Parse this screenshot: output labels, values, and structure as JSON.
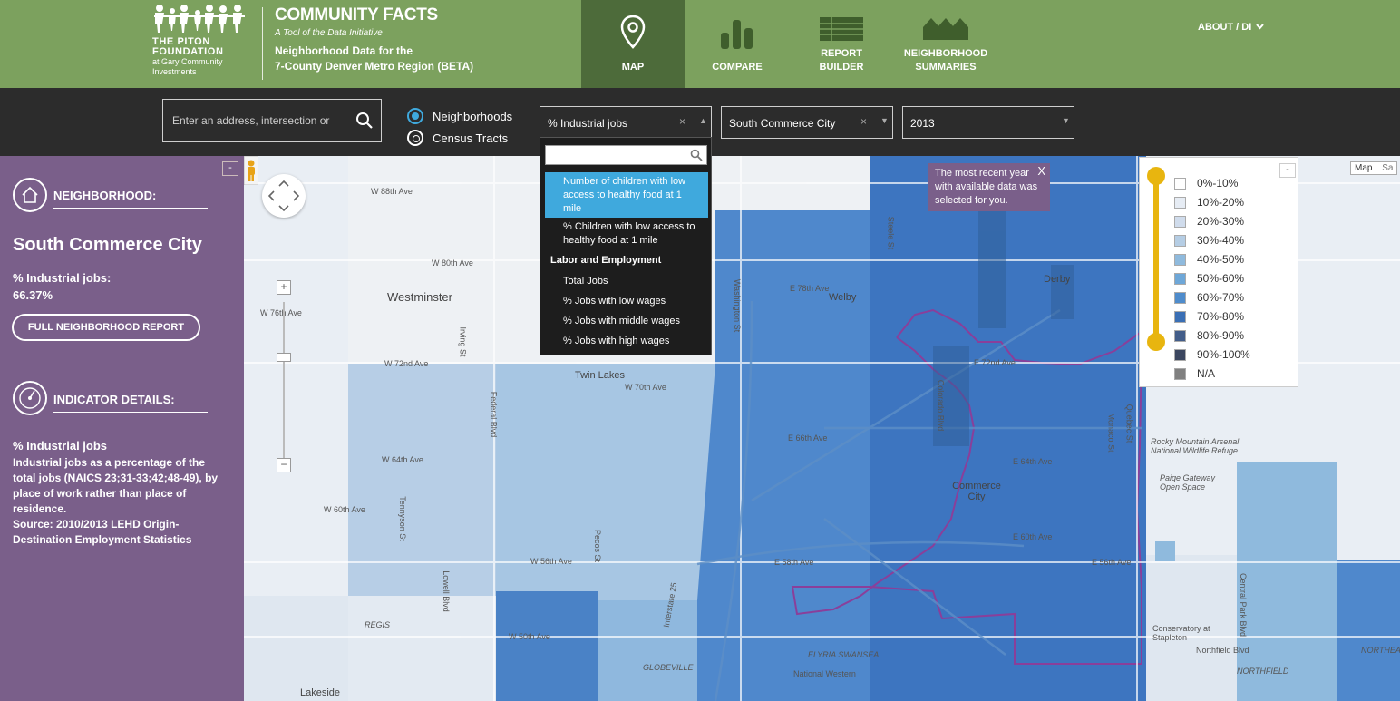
{
  "header": {
    "logo_name_line1": "THE PITON",
    "logo_name_line2": "FOUNDATION",
    "logo_sub_line1": "at Gary Community",
    "logo_sub_line2": "Investments",
    "title": "COMMUNITY FACTS",
    "tagline": "A Tool of the Data Initiative",
    "desc_line1": "Neighborhood Data for the",
    "desc_line2": "7-County Denver Metro Region (BETA)",
    "nav": [
      {
        "line1": "MAP",
        "line2": "",
        "icon": "map-pin-icon"
      },
      {
        "line1": "COMPARE",
        "line2": "",
        "icon": "bar-chart-icon"
      },
      {
        "line1": "REPORT",
        "line2": "BUILDER",
        "icon": "table-icon"
      },
      {
        "line1": "NEIGHBORHOOD",
        "line2": "SUMMARIES",
        "icon": "houses-icon"
      }
    ],
    "about": "ABOUT / DI",
    "about_icon": "chevron-down-icon"
  },
  "toolbar": {
    "search_placeholder": "Enter an address, intersection or",
    "geo_options": [
      "Neighborhoods",
      "Census Tracts"
    ],
    "indicator_value": "% Industrial jobs",
    "neighborhood_value": "South Commerce City",
    "year_value": "2013",
    "clear_glyph": "×"
  },
  "dropdown": {
    "items": [
      {
        "text": "Number of children with low access to healthy food at 1 mile",
        "selected": true
      },
      {
        "text": "% Children with low access to healthy food at 1 mile",
        "selected": false
      }
    ],
    "group": "Labor and Employment",
    "group_items": [
      "Total Jobs",
      "% Jobs with low wages",
      "% Jobs with middle wages",
      "% Jobs with high wages"
    ]
  },
  "sidebar": {
    "neighborhood_heading": "NEIGHBORHOOD:",
    "neighborhood_name": "South Commerce City",
    "value_label": "% Industrial jobs:",
    "value": "66.37%",
    "full_report_button": "FULL NEIGHBORHOOD REPORT",
    "indicator_heading": "INDICATOR DETAILS:",
    "indicator_title": "% Industrial jobs",
    "indicator_desc": "Industrial jobs as a percentage of the total jobs (NAICS 23;31-33;42;48-49), by place of work rather than place of residence.",
    "indicator_source": "Source: 2010/2013 LEHD Origin-Destination Employment Statistics",
    "collapse": "-"
  },
  "map": {
    "tooltip": "The most recent year with available data was selected for you.",
    "tooltip_close": "X",
    "maptype": [
      "Map",
      "Sa"
    ],
    "zoom_in": "+",
    "zoom_out": "−",
    "places": [
      "Westminster",
      "Twin Lakes",
      "Welby",
      "Derby",
      "Commerce City",
      "Lakeside",
      "GLOBEVILLE",
      "ELYRIA SWANSEA",
      "NORTHFIELD",
      "NORTHEAS",
      "National Western",
      "Conservatory at Stapleton",
      "Rocky Mountain Arsenal National Wildlife Refuge",
      "Paige Gateway Open Space",
      "REGIS"
    ],
    "streets": [
      "W 88th Ave",
      "W 80th Ave",
      "W 76th Ave",
      "W 72nd Ave",
      "W 70th Ave",
      "W 64th Ave",
      "W 60th Ave",
      "W 56th Ave",
      "W 50th Ave",
      "E 78th Ave",
      "E 72nd Ave",
      "E 66th Ave",
      "E 64th Ave",
      "E 60th Ave",
      "E 58th Ave",
      "E 56th Ave",
      "Federal Blvd",
      "Washington St",
      "Colorado Blvd",
      "Monaco St",
      "Pecos St",
      "Tennyson St",
      "Lowell Blvd",
      "Irving St",
      "Quebec St",
      "Steele St",
      "Central Park Blvd",
      "Northfield Blvd",
      "Interstate 25"
    ]
  },
  "legend": {
    "items": [
      {
        "label": "0%-10%",
        "color": "#ffffff"
      },
      {
        "label": "10%-20%",
        "color": "#e6ecf4"
      },
      {
        "label": "20%-30%",
        "color": "#d0dcec"
      },
      {
        "label": "30%-40%",
        "color": "#b5cde4"
      },
      {
        "label": "40%-50%",
        "color": "#8fbadd"
      },
      {
        "label": "50%-60%",
        "color": "#6ea7d8"
      },
      {
        "label": "60%-70%",
        "color": "#4f8ccc"
      },
      {
        "label": "70%-80%",
        "color": "#3a6fb5"
      },
      {
        "label": "80%-90%",
        "color": "#435d89"
      },
      {
        "label": "90%-100%",
        "color": "#3c4760"
      },
      {
        "label": "N/A",
        "color": "#808080"
      }
    ],
    "collapse": "-"
  },
  "colors": {
    "header_green": "#7ca15e",
    "active_tab": "#4d6b3a",
    "toolbar": "#2c2c2c",
    "sidebar_purple": "#7a5f8a",
    "accent_blue": "#3fa9dd",
    "slider_yellow": "#e8b50f",
    "boundary_purple": "#8a3f9a"
  }
}
